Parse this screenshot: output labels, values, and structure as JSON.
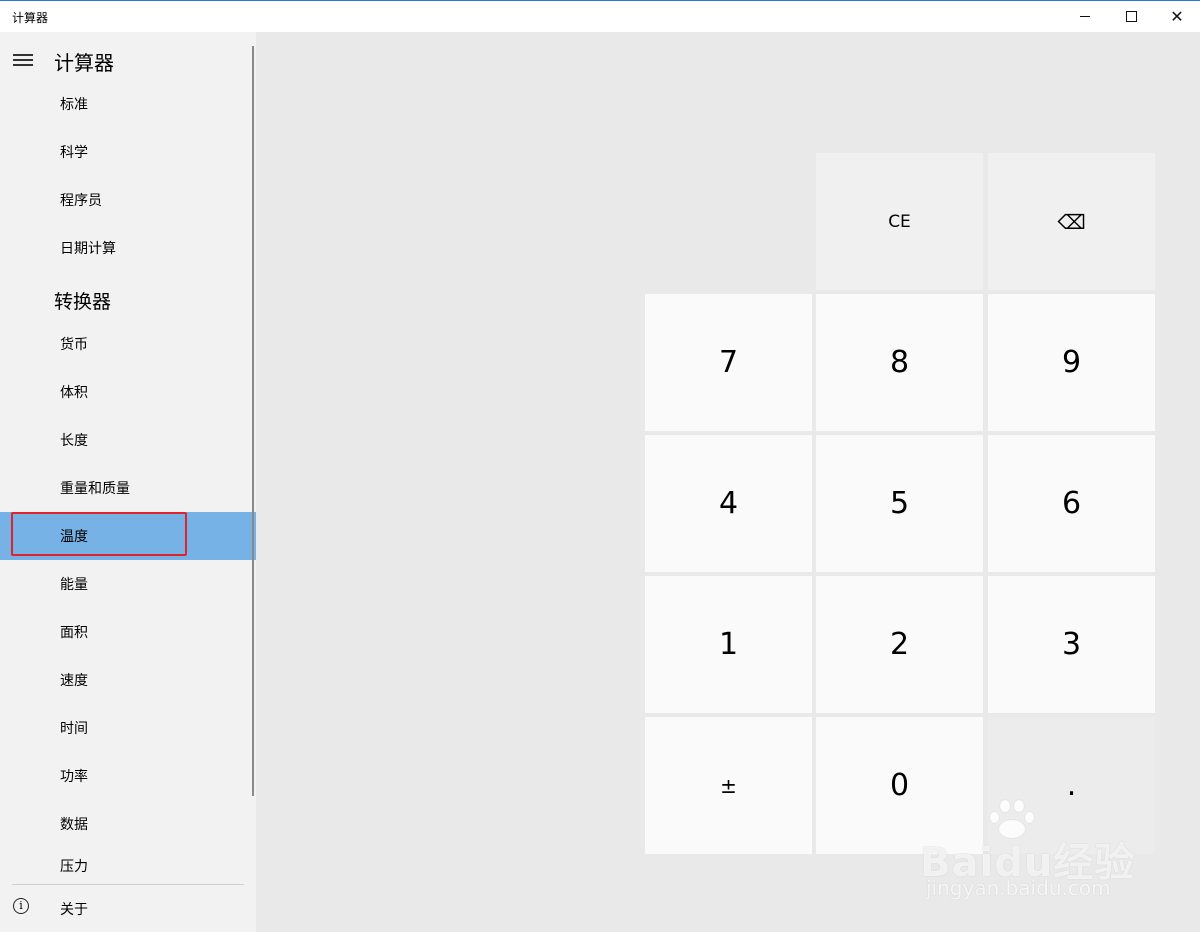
{
  "window": {
    "title": "计算器",
    "minimize_icon": "minimize-icon",
    "maximize_icon": "maximize-icon",
    "close_icon": "close-icon",
    "close_glyph": "✕"
  },
  "sidebar": {
    "menu_icon": "hamburger-icon",
    "header": "计算器",
    "calculator_items": [
      {
        "label": "标准"
      },
      {
        "label": "科学"
      },
      {
        "label": "程序员"
      },
      {
        "label": "日期计算"
      }
    ],
    "converter_header": "转换器",
    "converter_items": [
      {
        "label": "货币"
      },
      {
        "label": "体积"
      },
      {
        "label": "长度"
      },
      {
        "label": "重量和质量"
      },
      {
        "label": "温度",
        "selected": true
      },
      {
        "label": "能量"
      },
      {
        "label": "面积"
      },
      {
        "label": "速度"
      },
      {
        "label": "时间"
      },
      {
        "label": "功率"
      },
      {
        "label": "数据"
      },
      {
        "label": "压力"
      }
    ],
    "about": {
      "icon": "info-icon",
      "icon_glyph": "i",
      "label": "关于"
    },
    "selected_color": "#76b2e5",
    "highlight_border_color": "#e0242b"
  },
  "keypad": {
    "ce": "CE",
    "backspace_icon": "backspace-icon",
    "backspace_glyph": "⌫",
    "digits": {
      "d7": "7",
      "d8": "8",
      "d9": "9",
      "d4": "4",
      "d5": "5",
      "d6": "6",
      "d1": "1",
      "d2": "2",
      "d3": "3",
      "d0": "0"
    },
    "negate": "±",
    "decimal": "."
  },
  "watermark": {
    "logo": "Baidu经验",
    "url": "jingyan.baidu.com"
  }
}
